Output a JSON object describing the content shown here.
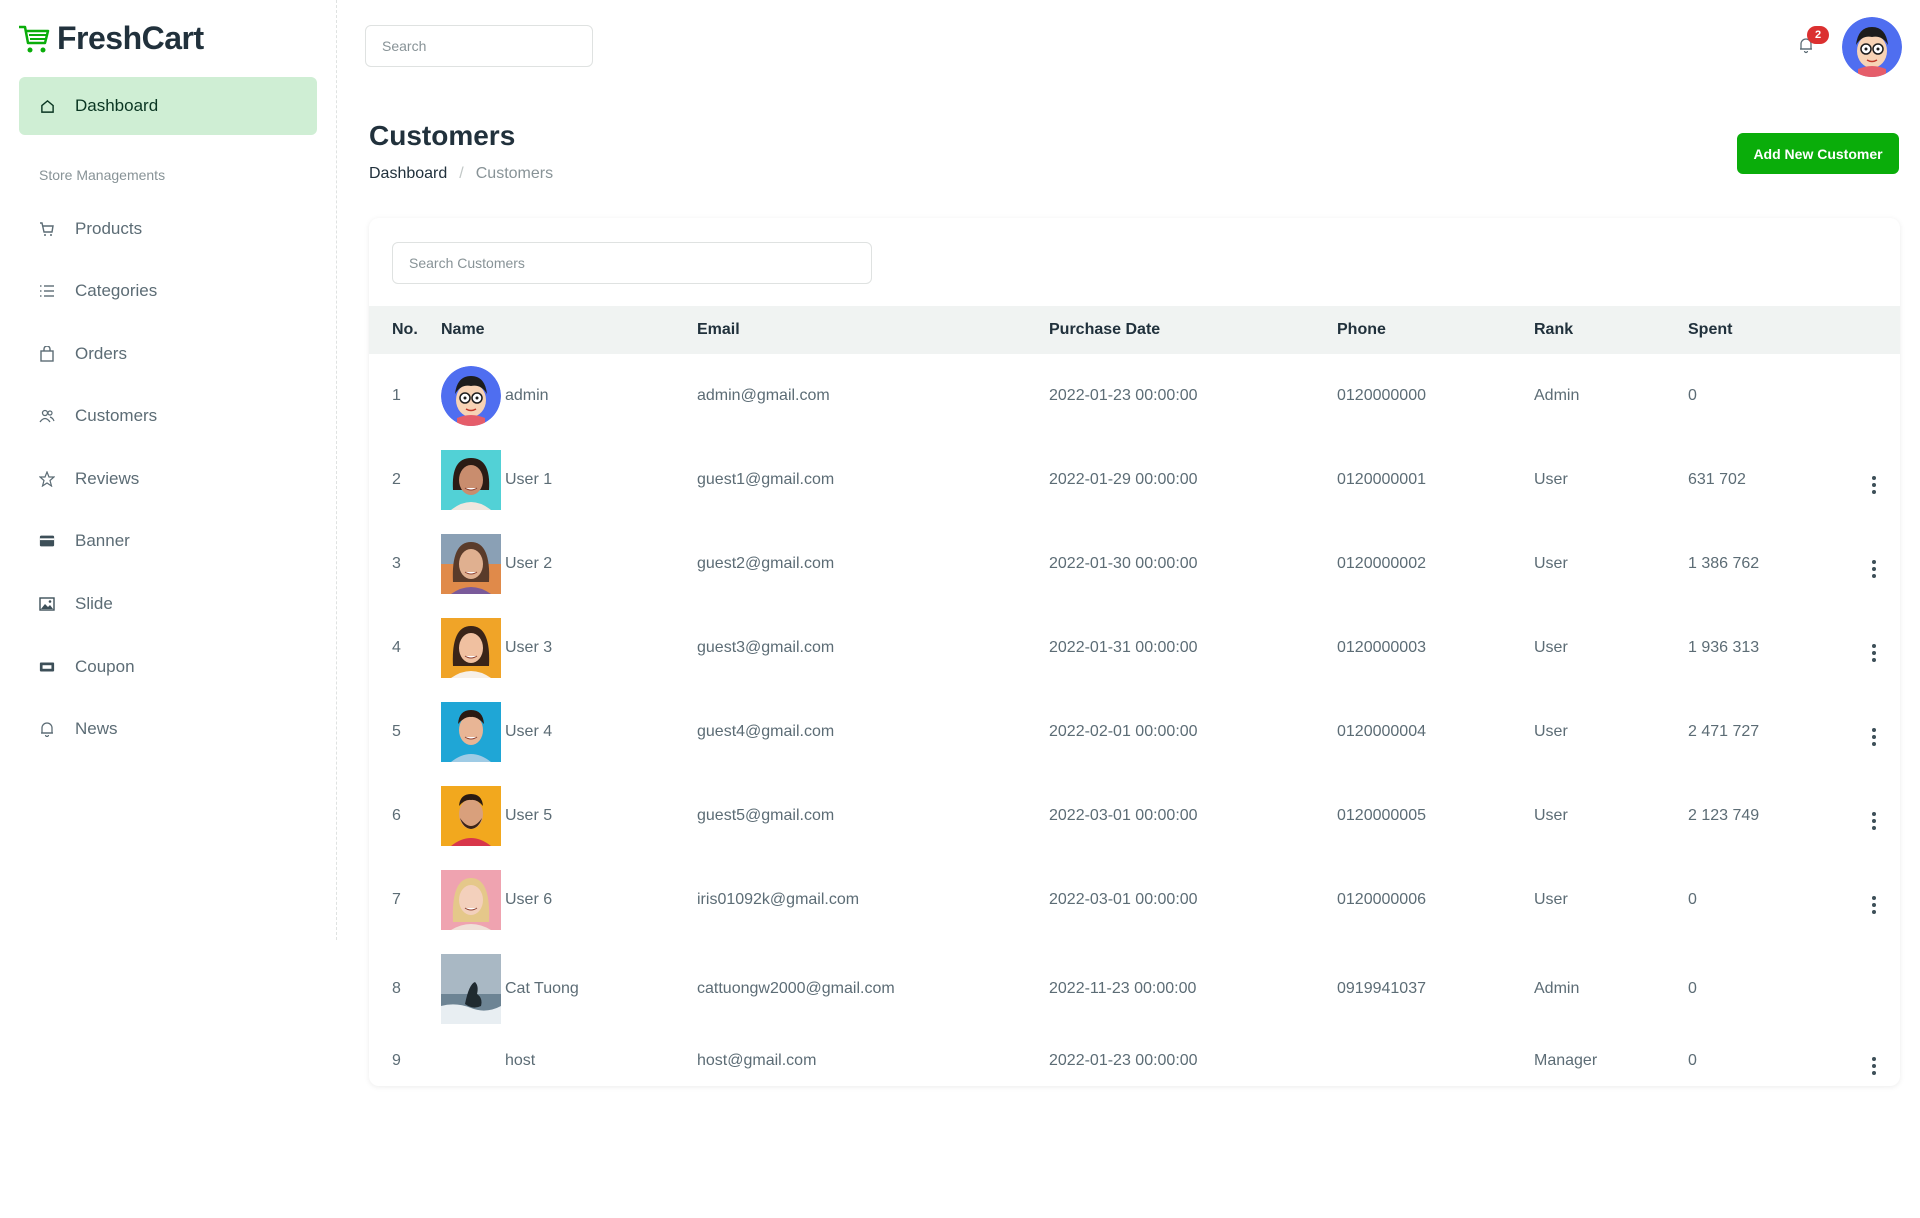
{
  "app": {
    "name": "FreshCart"
  },
  "sidebar": {
    "dashboard_label": "Dashboard",
    "section_title": "Store Managements",
    "items": [
      {
        "label": "Products",
        "icon": "cart-icon"
      },
      {
        "label": "Categories",
        "icon": "list-icon"
      },
      {
        "label": "Orders",
        "icon": "bag-icon"
      },
      {
        "label": "Customers",
        "icon": "people-icon"
      },
      {
        "label": "Reviews",
        "icon": "star-icon"
      },
      {
        "label": "Banner",
        "icon": "card-icon"
      },
      {
        "label": "Slide",
        "icon": "image-icon"
      },
      {
        "label": "Coupon",
        "icon": "ticket-icon"
      },
      {
        "label": "News",
        "icon": "bell-icon"
      }
    ]
  },
  "topbar": {
    "search_placeholder": "Search",
    "notification_count": "2"
  },
  "header": {
    "title": "Customers",
    "breadcrumb": {
      "home": "Dashboard",
      "separator": "/",
      "current": "Customers"
    },
    "add_button": "Add New Customer"
  },
  "customers": {
    "search_placeholder": "Search Customers",
    "columns": {
      "no": "No.",
      "name": "Name",
      "email": "Email",
      "date": "Purchase Date",
      "phone": "Phone",
      "rank": "Rank",
      "spent": "Spent"
    },
    "rows": [
      {
        "no": "1",
        "name": "admin",
        "email": "admin@gmail.com",
        "date": "2022-01-23 00:00:00",
        "phone": "0120000000",
        "rank": "Admin",
        "spent": "0"
      },
      {
        "no": "2",
        "name": "User 1",
        "email": "guest1@gmail.com",
        "date": "2022-01-29 00:00:00",
        "phone": "0120000001",
        "rank": "User",
        "spent": "631 702"
      },
      {
        "no": "3",
        "name": "User 2",
        "email": "guest2@gmail.com",
        "date": "2022-01-30 00:00:00",
        "phone": "0120000002",
        "rank": "User",
        "spent": "1 386 762"
      },
      {
        "no": "4",
        "name": "User 3",
        "email": "guest3@gmail.com",
        "date": "2022-01-31 00:00:00",
        "phone": "0120000003",
        "rank": "User",
        "spent": "1 936 313"
      },
      {
        "no": "5",
        "name": "User 4",
        "email": "guest4@gmail.com",
        "date": "2022-02-01 00:00:00",
        "phone": "0120000004",
        "rank": "User",
        "spent": "2 471 727"
      },
      {
        "no": "6",
        "name": "User 5",
        "email": "guest5@gmail.com",
        "date": "2022-03-01 00:00:00",
        "phone": "0120000005",
        "rank": "User",
        "spent": "2 123 749"
      },
      {
        "no": "7",
        "name": "User 6",
        "email": "iris01092k@gmail.com",
        "date": "2022-03-01 00:00:00",
        "phone": "0120000006",
        "rank": "User",
        "spent": "0"
      },
      {
        "no": "8",
        "name": "Cat Tuong",
        "email": "cattuongw2000@gmail.com",
        "date": "2022-11-23 00:00:00",
        "phone": "0919941037",
        "rank": "Admin",
        "spent": "0"
      },
      {
        "no": "9",
        "name": "host",
        "email": "host@gmail.com",
        "date": "2022-01-23 00:00:00",
        "phone": "",
        "rank": "Manager",
        "spent": "0"
      }
    ]
  },
  "colors": {
    "brand_green": "#0aad0a",
    "active_nav_bg": "#cfeed4",
    "badge_red": "#db3030",
    "table_header_bg": "#f0f3f2"
  }
}
